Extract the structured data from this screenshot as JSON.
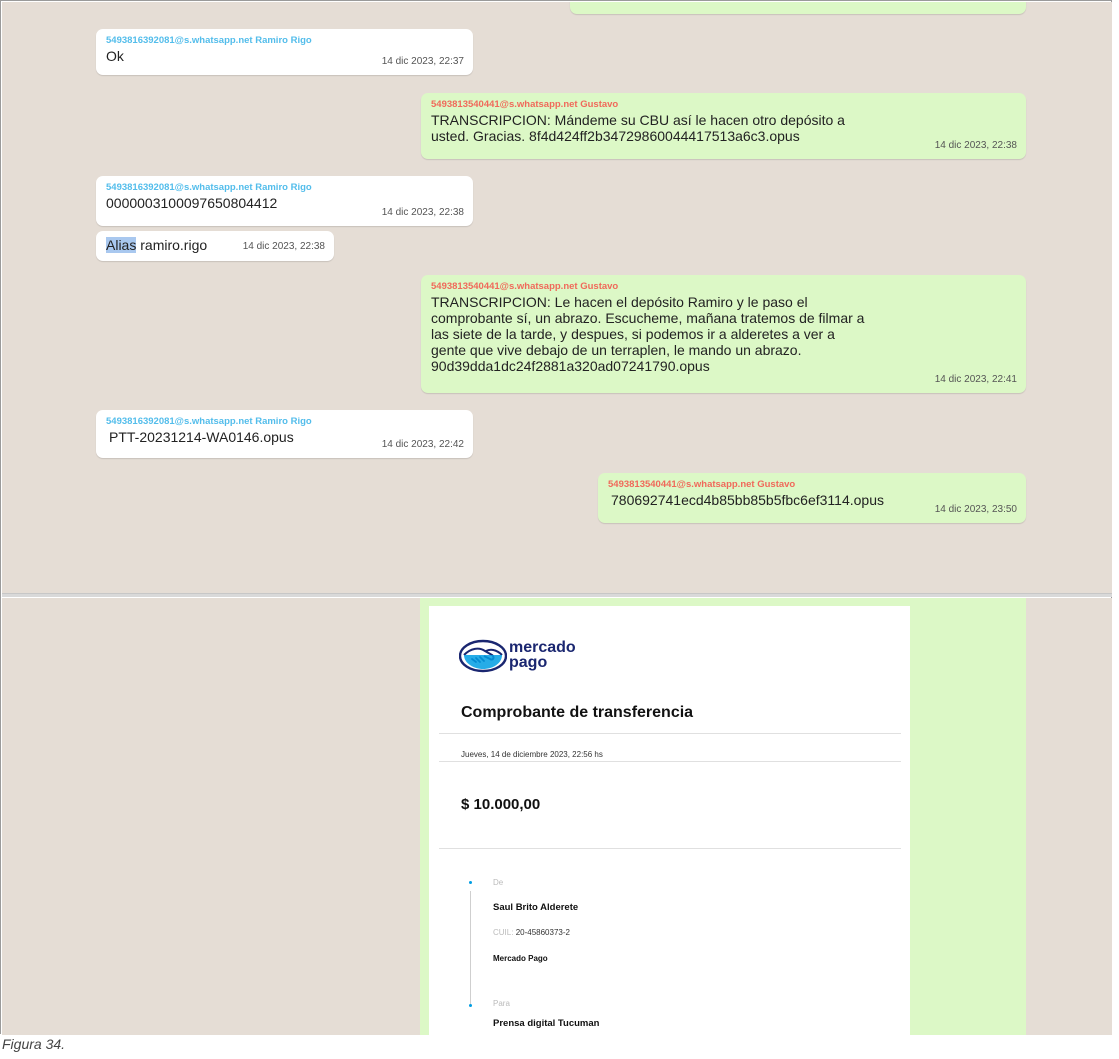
{
  "messages": [
    {
      "sender": "5493816392081@s.whatsapp.net Ramiro Rigo",
      "text": "Ok",
      "time": "14 dic 2023, 22:37"
    },
    {
      "sender": "5493813540441@s.whatsapp.net Gustavo",
      "text": "TRANSCRIPCION: Mándeme su CBU así le hacen otro depósito a\nusted. Gracias. 8f4d424ff2b34729860044417513a6c3.opus",
      "time": "14 dic 2023, 22:38"
    },
    {
      "sender": "5493816392081@s.whatsapp.net Ramiro Rigo",
      "text": "0000003100097650804412",
      "time": "14 dic 2023, 22:38"
    },
    {
      "highlight": "Alias",
      "text": " ramiro.rigo",
      "time": "14 dic 2023, 22:38"
    },
    {
      "sender": "5493813540441@s.whatsapp.net Gustavo",
      "text": "TRANSCRIPCION: Le hacen el depósito Ramiro y le paso el\ncomprobante sí, un abrazo. Escucheme, mañana tratemos de filmar a\nlas siete de la tarde, y despues, si podemos ir a alderetes a ver a\ngente que vive debajo de un terraplen, le mando un abrazo.\n90d39dda1dc24f2881a320ad07241790.opus",
      "time": "14 dic 2023, 22:41"
    },
    {
      "sender": "5493816392081@s.whatsapp.net Ramiro Rigo",
      "text": "PTT-20231214-WA0146.opus",
      "time": "14 dic 2023, 22:42"
    },
    {
      "sender": "5493813540441@s.whatsapp.net Gustavo",
      "text": "780692741ecd4b85bb85b5fbc6ef3114.opus",
      "time": "14 dic 2023, 23:50"
    }
  ],
  "receipt": {
    "logo_line1": "mercado",
    "logo_line2": "pago",
    "title": "Comprobante de transferencia",
    "date": "Jueves, 14 de diciembre 2023, 22:56 hs",
    "amount": "$ 10.000,00",
    "from_label": "De",
    "from_name": "Saul Brito Alderete",
    "cuil_label": "CUIL:",
    "cuil_value": "20-45860373-2",
    "from_bank": "Mercado Pago",
    "to_label": "Para",
    "to_name": "Prensa digital Tucuman"
  },
  "caption": "Figura 34.",
  "colors": {
    "chat_bg": "#e5ddd5",
    "incoming": "#ffffff",
    "outgoing": "#dcf8c6",
    "sender_in": "#53bdeb",
    "sender_out": "#f0695a",
    "mp_navy": "#1a2670",
    "mp_blue": "#009ee3"
  }
}
